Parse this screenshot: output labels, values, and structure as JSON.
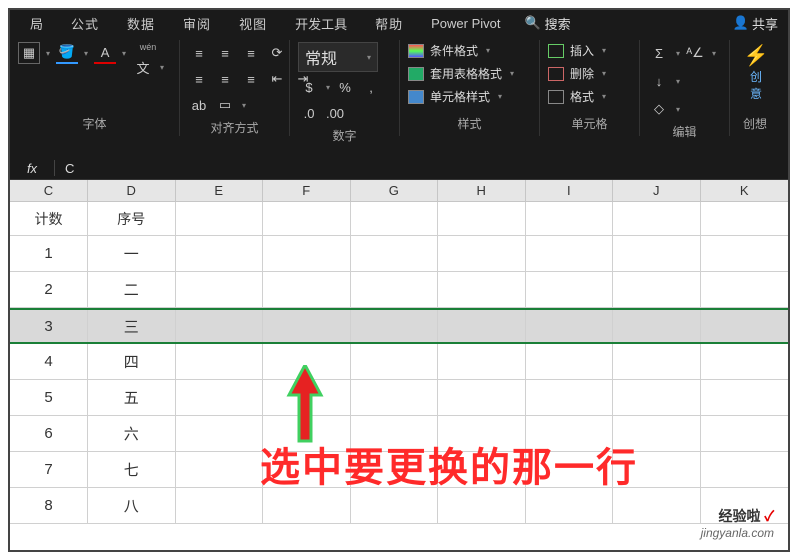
{
  "tabs": {
    "t0": "局",
    "t1": "公式",
    "t2": "数据",
    "t3": "审阅",
    "t4": "视图",
    "t5": "开发工具",
    "t6": "帮助",
    "t7": "Power Pivot"
  },
  "search": {
    "icon": "🔍",
    "label": "搜索"
  },
  "share": {
    "icon": "👤",
    "label": "共享"
  },
  "font": {
    "char_a1": "A",
    "char_a2": "A",
    "wen": "wén",
    "wen_char": "文",
    "drop": "▾",
    "label": "字体"
  },
  "align": {
    "label": "对齐方式",
    "wrap": "ab"
  },
  "number": {
    "format": "常规",
    "drop": "▾",
    "currency": "$",
    "percent": "%",
    "comma": ",",
    "dec_inc": ".0",
    "dec_dec": ".00",
    "label": "数字"
  },
  "styles": {
    "cond": "条件格式",
    "table": "套用表格格式",
    "cell": "单元格样式",
    "drop": "▾",
    "label": "样式"
  },
  "cells": {
    "insert": "插入",
    "delete": "删除",
    "format": "格式",
    "drop": "▾",
    "label": "单元格"
  },
  "editing": {
    "sum": "Σ",
    "sort": "ᴬ∠",
    "drop": "▾",
    "label": "编辑"
  },
  "idea": {
    "l1": "创",
    "l2": "意",
    "label": "创想"
  },
  "fx": {
    "symbol": "fx",
    "value": "C"
  },
  "cols": {
    "C": "C",
    "D": "D",
    "E": "E",
    "F": "F",
    "G": "G",
    "H": "H",
    "I": "I",
    "J": "J",
    "K": "K"
  },
  "header_row": {
    "c": "计数",
    "d": "序号"
  },
  "rows": [
    {
      "c": "1",
      "d": "一"
    },
    {
      "c": "2",
      "d": "二"
    },
    {
      "c": "3",
      "d": "三"
    },
    {
      "c": "4",
      "d": "四"
    },
    {
      "c": "5",
      "d": "五"
    },
    {
      "c": "6",
      "d": "六"
    },
    {
      "c": "7",
      "d": "七"
    },
    {
      "c": "8",
      "d": "八"
    }
  ],
  "annotation": "选中要更换的那一行",
  "watermark": {
    "line1": "经验啦",
    "check": "✓",
    "line2": "jingyanla.com"
  }
}
